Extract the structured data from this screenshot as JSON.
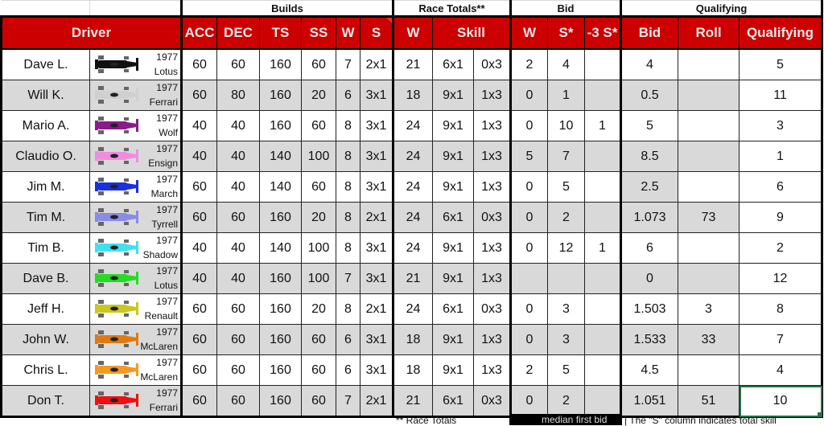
{
  "group_headers": {
    "builds": "Builds",
    "race_totals": "Race Totals**",
    "bid": "Bid",
    "qualifying": "Qualifying"
  },
  "column_headers": {
    "driver": "Driver",
    "acc": "ACC",
    "dec": "DEC",
    "ts": "TS",
    "ss": "SS",
    "build_w": "W",
    "build_s": "S",
    "race_w": "W",
    "skill": "Skill",
    "bid_w": "W",
    "bid_s": "S*",
    "minus3s": "-3 S*",
    "bid": "Bid",
    "roll": "Roll",
    "qualifying": "Qualifying"
  },
  "car_icon_colors": {
    "lotus_black": "#111111",
    "ferrari_white": "#d0d0d0",
    "wolf": "#8b1a8b",
    "ensign": "#f08ce0",
    "march": "#1a2fe0",
    "tyrrell": "#8a8ae8",
    "shadow": "#40e0f0",
    "lotus_green": "#22dd22",
    "renault": "#c8c820",
    "mclaren_dark": "#e07a10",
    "mclaren": "#f59a20",
    "ferrari_red": "#ee1111"
  },
  "rows": [
    {
      "driver": "Dave L.",
      "year": "1977",
      "make": "Lotus",
      "car_color": "#111111",
      "car_icon": "car-lotus-black-icon",
      "acc": "60",
      "dec": "60",
      "ts": "160",
      "ss": "60",
      "bw": "7",
      "bs": "2x1",
      "rw": "21",
      "sk1": "6x1",
      "sk2": "0x3",
      "w": "2",
      "s": "4",
      "m3": "",
      "bid": "4",
      "roll": "",
      "q": "5"
    },
    {
      "driver": "Will K.",
      "year": "1977",
      "make": "Ferrari",
      "car_color": "#d0d0d0",
      "car_icon": "car-ferrari-white-icon",
      "acc": "60",
      "dec": "80",
      "ts": "160",
      "ss": "20",
      "bw": "6",
      "bs": "3x1",
      "rw": "18",
      "sk1": "9x1",
      "sk2": "1x3",
      "w": "0",
      "s": "1",
      "m3": "",
      "bid": "0.5",
      "roll": "",
      "q": "11"
    },
    {
      "driver": "Mario A.",
      "year": "1977",
      "make": "Wolf",
      "car_color": "#8b1a8b",
      "car_icon": "car-wolf-icon",
      "acc": "40",
      "dec": "40",
      "ts": "160",
      "ss": "60",
      "bw": "8",
      "bs": "3x1",
      "rw": "24",
      "sk1": "9x1",
      "sk2": "1x3",
      "w": "0",
      "s": "10",
      "m3": "1",
      "bid": "5",
      "roll": "",
      "q": "3"
    },
    {
      "driver": "Claudio O.",
      "year": "1977",
      "make": "Ensign",
      "car_color": "#f08ce0",
      "car_icon": "car-ensign-icon",
      "acc": "40",
      "dec": "40",
      "ts": "140",
      "ss": "100",
      "bw": "8",
      "bs": "3x1",
      "rw": "24",
      "sk1": "9x1",
      "sk2": "1x3",
      "w": "5",
      "s": "7",
      "m3": "",
      "bid": "8.5",
      "roll": "",
      "q": "1"
    },
    {
      "driver": "Jim M.",
      "year": "1977",
      "make": "March",
      "car_color": "#1a2fe0",
      "car_icon": "car-march-icon",
      "acc": "60",
      "dec": "40",
      "ts": "140",
      "ss": "60",
      "bw": "8",
      "bs": "3x1",
      "rw": "24",
      "sk1": "9x1",
      "sk2": "1x3",
      "w": "0",
      "s": "5",
      "m3": "",
      "bid": "2.5",
      "roll": "",
      "q": "6"
    },
    {
      "driver": "Tim M.",
      "year": "1977",
      "make": "Tyrrell",
      "car_color": "#8a8ae8",
      "car_icon": "car-tyrrell-icon",
      "acc": "60",
      "dec": "60",
      "ts": "160",
      "ss": "20",
      "bw": "8",
      "bs": "2x1",
      "rw": "24",
      "sk1": "6x1",
      "sk2": "0x3",
      "w": "0",
      "s": "2",
      "m3": "",
      "bid": "1.073",
      "roll": "73",
      "q": "9"
    },
    {
      "driver": "Tim B.",
      "year": "1977",
      "make": "Shadow",
      "car_color": "#40e0f0",
      "car_icon": "car-shadow-icon",
      "acc": "40",
      "dec": "40",
      "ts": "140",
      "ss": "100",
      "bw": "8",
      "bs": "3x1",
      "rw": "24",
      "sk1": "9x1",
      "sk2": "1x3",
      "w": "0",
      "s": "12",
      "m3": "1",
      "bid": "6",
      "roll": "",
      "q": "2"
    },
    {
      "driver": "Dave B.",
      "year": "1977",
      "make": "Lotus",
      "car_color": "#22dd22",
      "car_icon": "car-lotus-green-icon",
      "acc": "40",
      "dec": "40",
      "ts": "160",
      "ss": "100",
      "bw": "7",
      "bs": "3x1",
      "rw": "21",
      "sk1": "9x1",
      "sk2": "1x3",
      "w": "",
      "s": "",
      "m3": "",
      "bid": "0",
      "roll": "",
      "q": "12"
    },
    {
      "driver": "Jeff H.",
      "year": "1977",
      "make": "Renault",
      "car_color": "#c8c820",
      "car_icon": "car-renault-icon",
      "acc": "60",
      "dec": "60",
      "ts": "160",
      "ss": "20",
      "bw": "8",
      "bs": "2x1",
      "rw": "24",
      "sk1": "6x1",
      "sk2": "0x3",
      "w": "0",
      "s": "3",
      "m3": "",
      "bid": "1.503",
      "roll": "3",
      "q": "8"
    },
    {
      "driver": "John W.",
      "year": "1977",
      "make": "McLaren",
      "car_color": "#e07a10",
      "car_icon": "car-mclaren-icon",
      "acc": "60",
      "dec": "60",
      "ts": "160",
      "ss": "60",
      "bw": "6",
      "bs": "3x1",
      "rw": "18",
      "sk1": "9x1",
      "sk2": "1x3",
      "w": "0",
      "s": "3",
      "m3": "",
      "bid": "1.533",
      "roll": "33",
      "q": "7"
    },
    {
      "driver": "Chris L.",
      "year": "1977",
      "make": "McLaren",
      "car_color": "#f59a20",
      "car_icon": "car-mclaren-icon",
      "acc": "60",
      "dec": "60",
      "ts": "160",
      "ss": "60",
      "bw": "6",
      "bs": "3x1",
      "rw": "18",
      "sk1": "9x1",
      "sk2": "1x3",
      "w": "2",
      "s": "5",
      "m3": "",
      "bid": "4.5",
      "roll": "",
      "q": "4"
    },
    {
      "driver": "Don T.",
      "year": "1977",
      "make": "Ferrari",
      "car_color": "#ee1111",
      "car_icon": "car-ferrari-red-icon",
      "acc": "60",
      "dec": "60",
      "ts": "160",
      "ss": "60",
      "bw": "7",
      "bs": "2x1",
      "rw": "21",
      "sk1": "6x1",
      "sk2": "0x3",
      "w": "0",
      "s": "2",
      "m3": "",
      "bid": "1.051",
      "roll": "51",
      "q": "10"
    }
  ],
  "footer": {
    "note1": "** Race Totals",
    "note2": "median first bid",
    "note3": "| The \"S\" column indicates total skill"
  },
  "colors": {
    "header_red": "#cc0000",
    "header_text": "#e8e8e8",
    "alt_row": "#d9d9d9",
    "selection": "#217346"
  }
}
